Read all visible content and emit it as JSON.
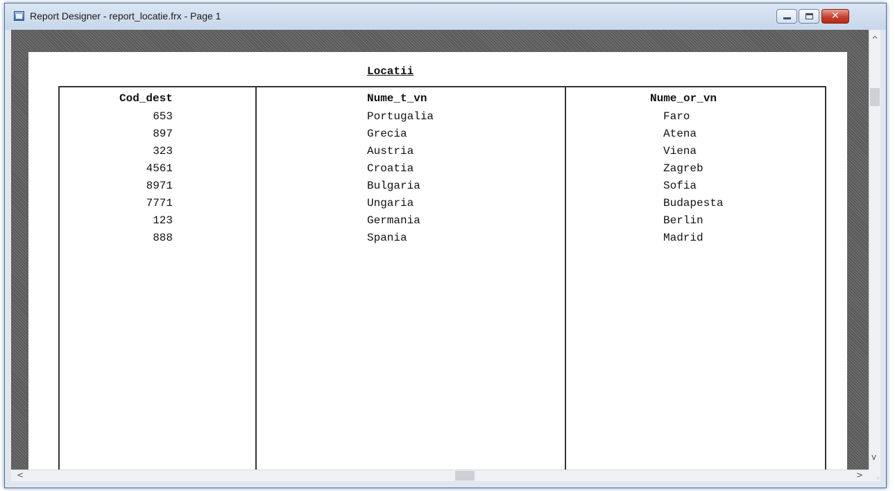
{
  "window": {
    "title": "Report Designer - report_locatie.frx - Page 1"
  },
  "report": {
    "title": "Locatii",
    "columns": [
      "Cod_dest",
      "Nume_t_vn",
      "Nume_or_vn"
    ],
    "rows": [
      [
        "653",
        "Portugalia",
        "Faro"
      ],
      [
        "897",
        "Grecia",
        "Atena"
      ],
      [
        "323",
        "Austria",
        "Viena"
      ],
      [
        "4561",
        "Croatia",
        "Zagreb"
      ],
      [
        "8971",
        "Bulgaria",
        "Sofia"
      ],
      [
        "7771",
        "Ungaria",
        "Budapesta"
      ],
      [
        "123",
        "Germania",
        "Berlin"
      ],
      [
        "888",
        "Spania",
        "Madrid"
      ]
    ]
  }
}
